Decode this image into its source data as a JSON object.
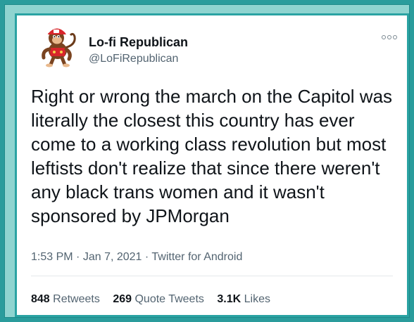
{
  "tweet": {
    "display_name": "Lo-fi Republican",
    "handle": "@LoFiRepublican",
    "avatar_icon": "monkey-mascot-avatar",
    "text": "Right or wrong the march on the Capitol was literally the closest this country has ever come to a working class revolution but most leftists don't realize that since there weren't any black trans women and it wasn't sponsored by JPMorgan",
    "time": "1:53 PM",
    "separator": "·",
    "date": "Jan 7, 2021",
    "source": "Twitter for Android",
    "stats": {
      "retweets_count": "848",
      "retweets_label": "Retweets",
      "quote_count": "269",
      "quote_label": "Quote Tweets",
      "likes_count": "3.1K",
      "likes_label": "Likes"
    }
  },
  "colors": {
    "border_teal": "#2aa3a3",
    "frame_light": "#8fd4d0",
    "text_primary": "#0f1419",
    "text_secondary": "#536471"
  }
}
